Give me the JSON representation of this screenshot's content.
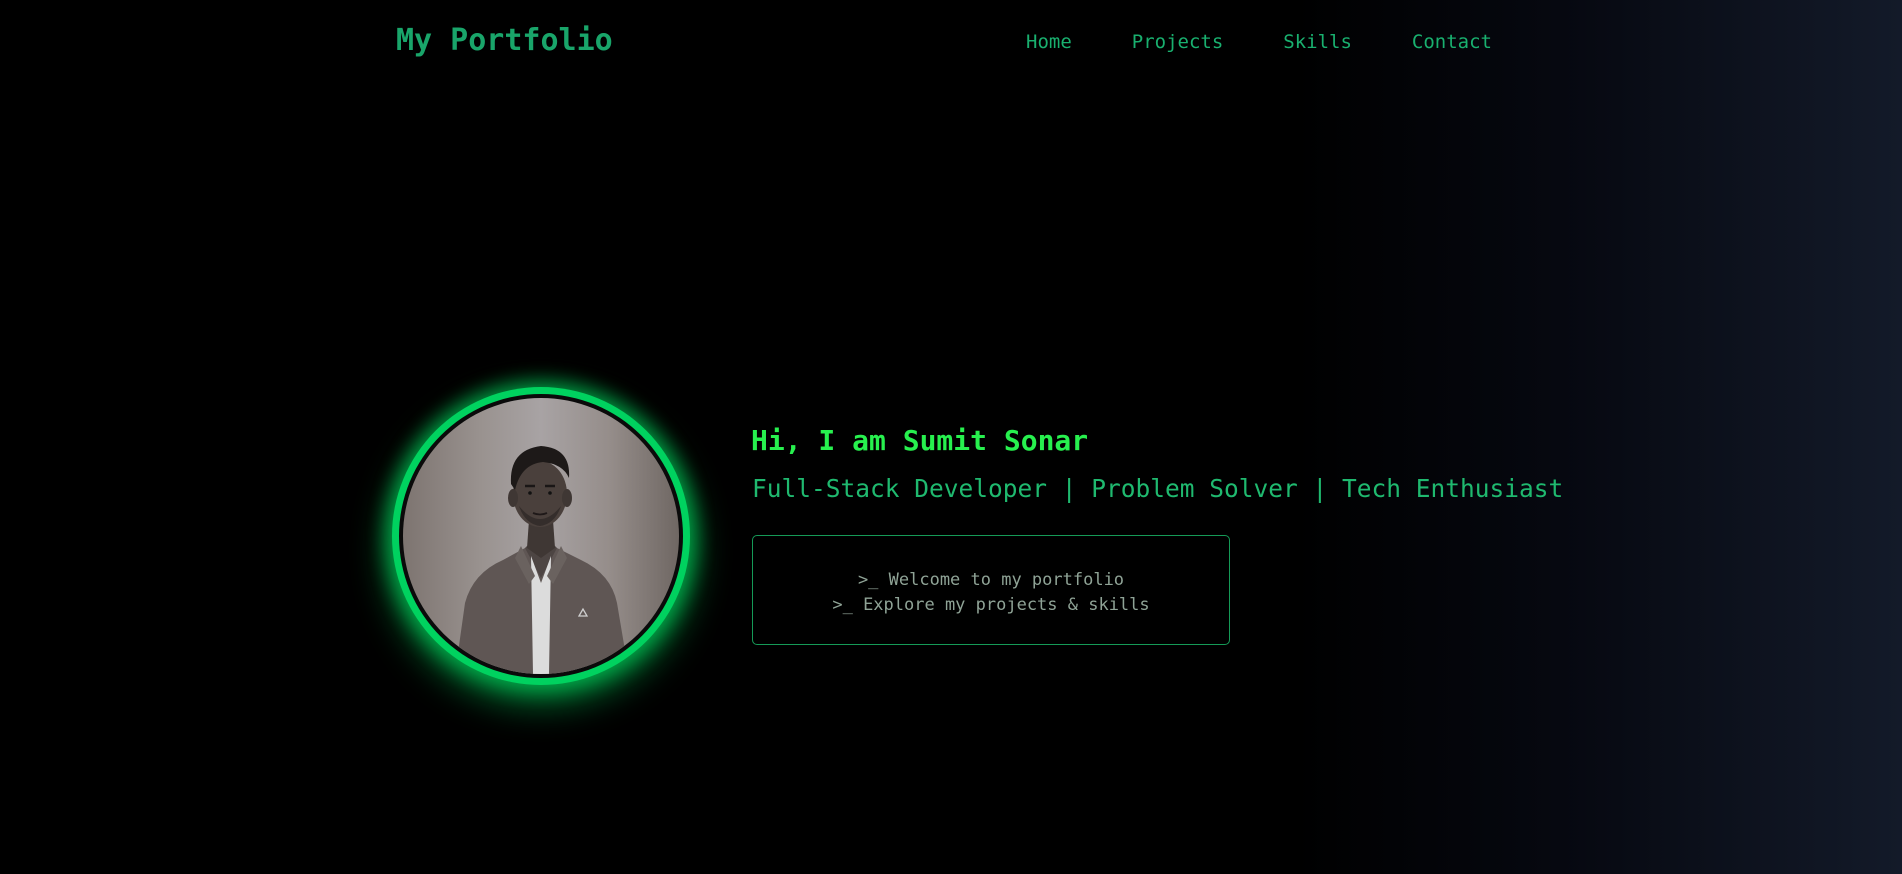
{
  "header": {
    "logo": "My Portfolio",
    "nav": [
      "Home",
      "Projects",
      "Skills",
      "Contact"
    ]
  },
  "hero": {
    "greeting": "Hi, I am Sumit Sonar",
    "tagline": "Full-Stack Developer | Problem Solver | Tech Enthusiast",
    "terminal": [
      ">_ Welcome to my portfolio",
      ">_ Explore my projects & skills"
    ]
  },
  "colors": {
    "accent": "#27f04e",
    "ring": "#00d25f",
    "text_green": "#1fb96f",
    "terminal_text": "#8fa396",
    "background": "#000000",
    "background_right": "#131a29"
  },
  "icons": {
    "profile_photo": "profile-photo"
  }
}
